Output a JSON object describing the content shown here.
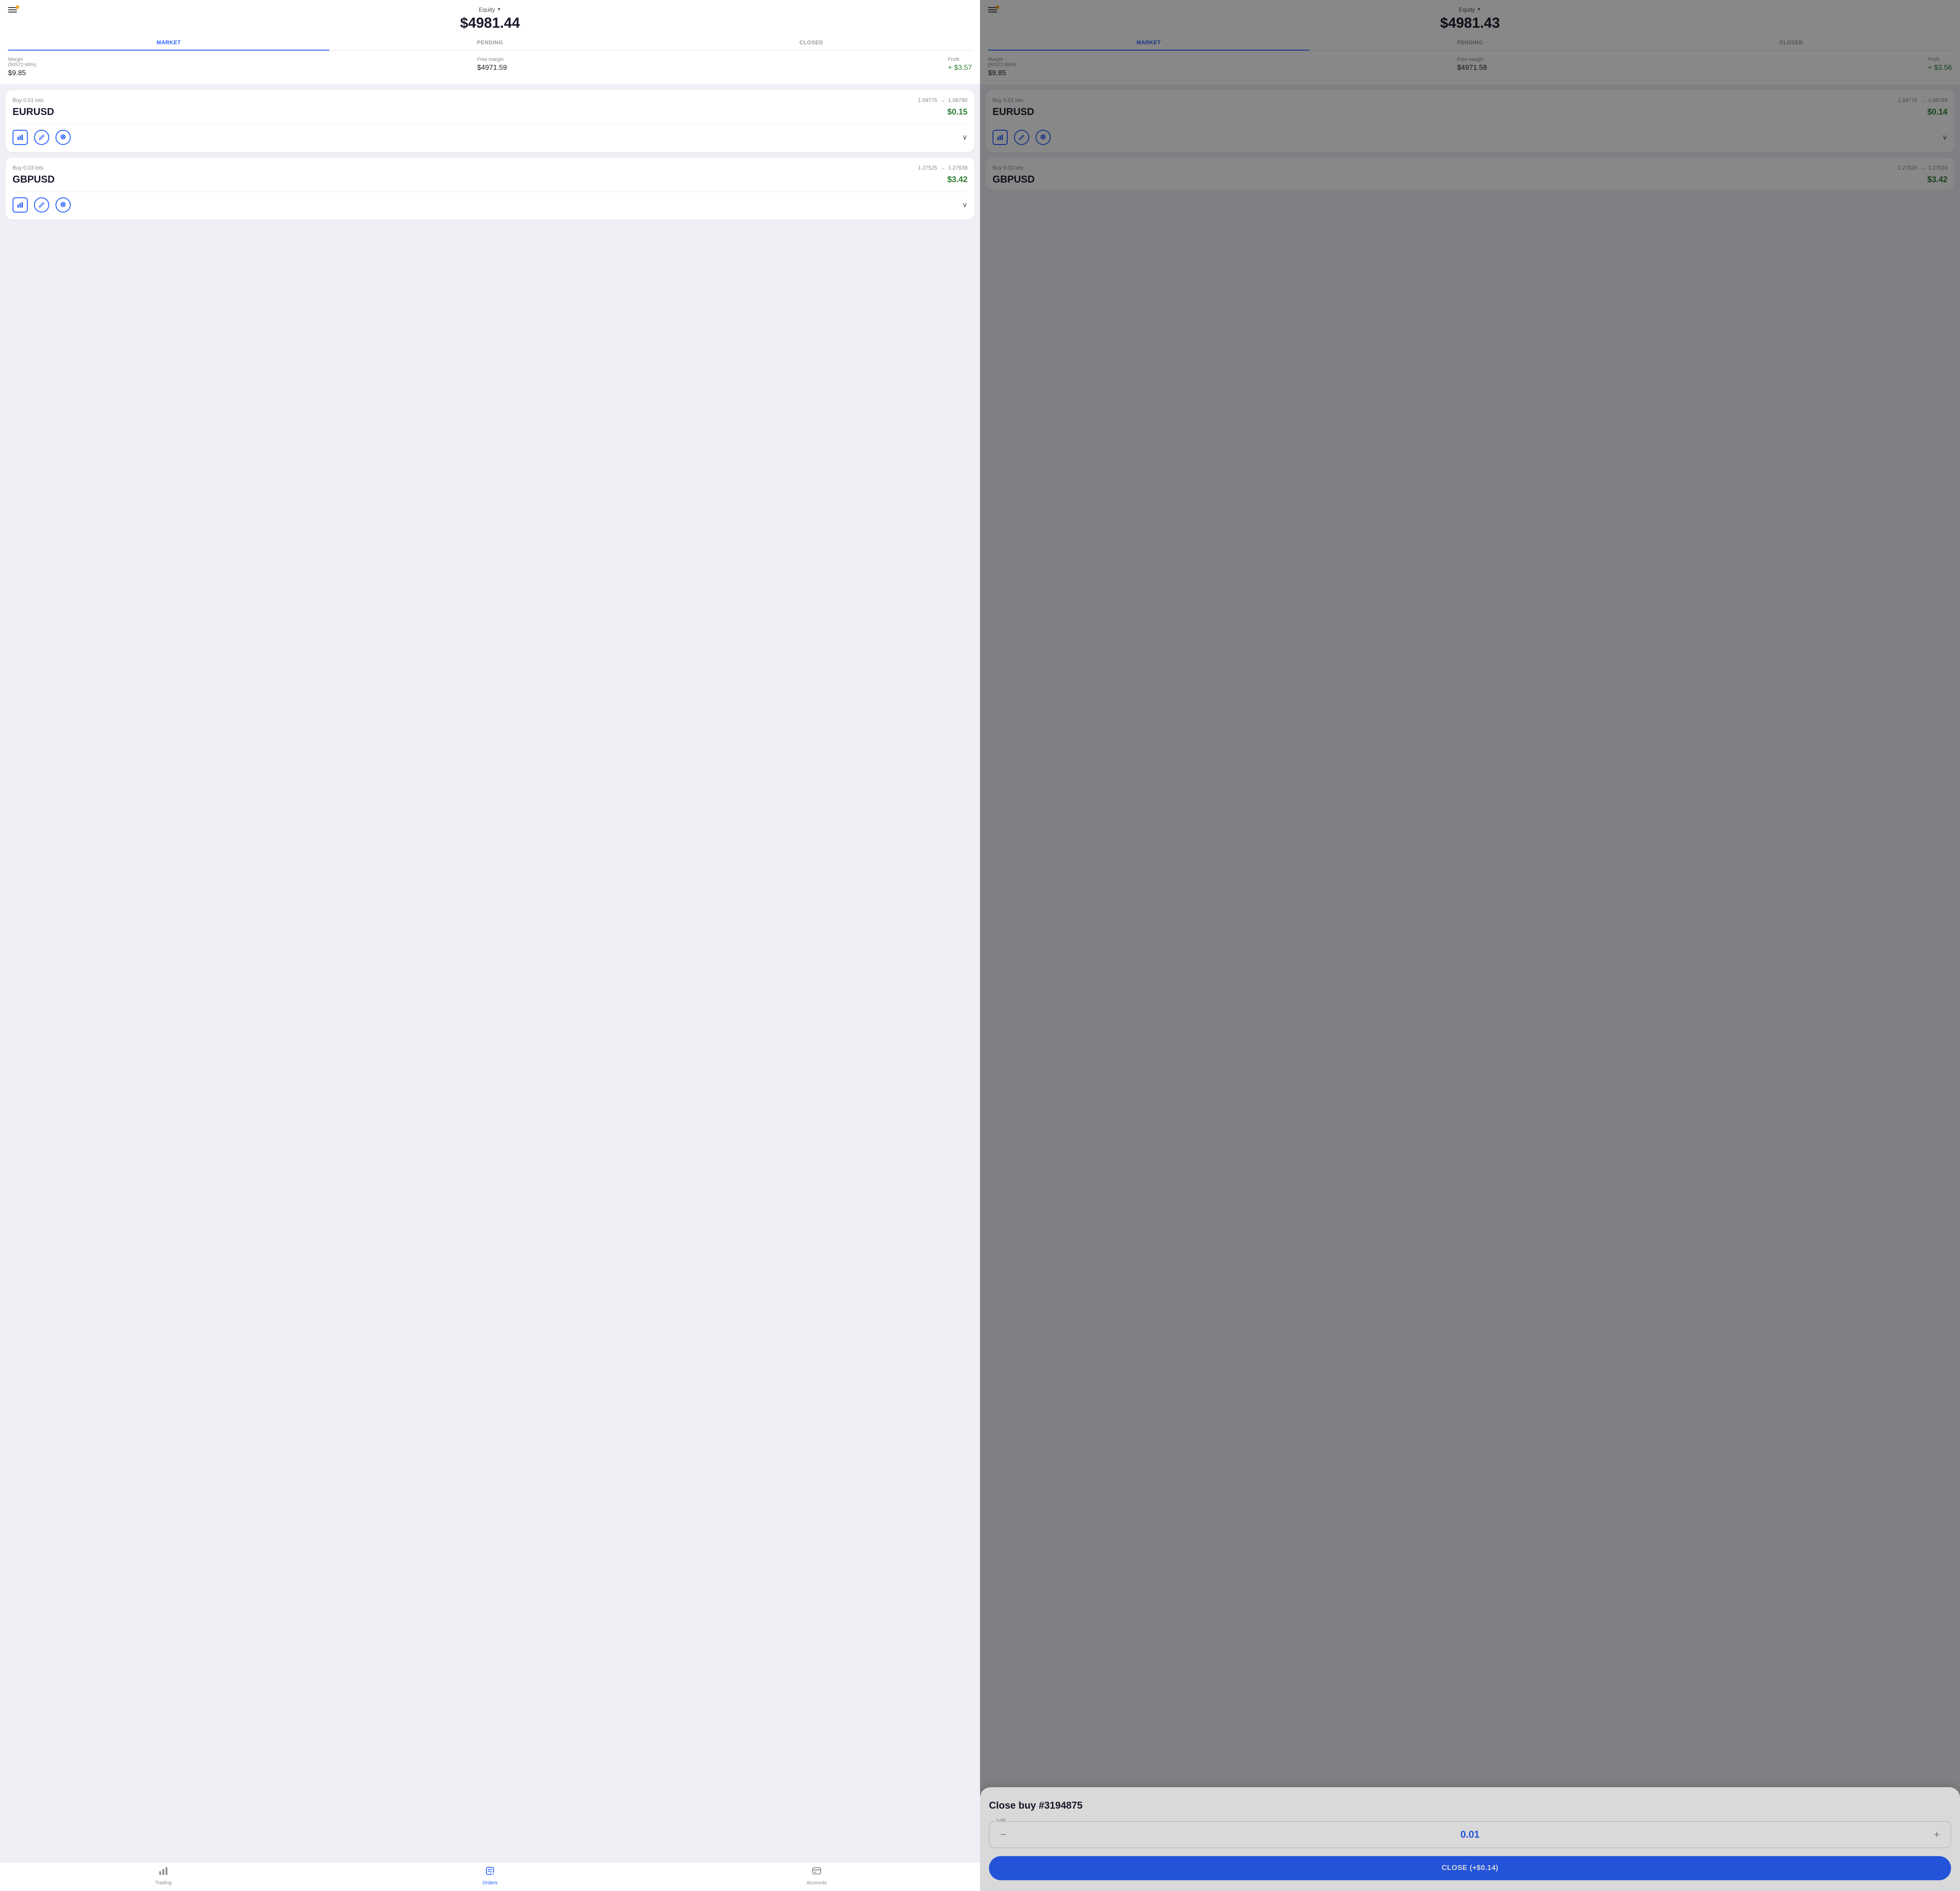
{
  "left": {
    "equity_label": "Equity",
    "equity_value": "$4981.44",
    "tabs": [
      {
        "id": "market",
        "label": "MARKET",
        "active": true
      },
      {
        "id": "pending",
        "label": "PENDING",
        "active": false
      },
      {
        "id": "closed",
        "label": "CLOSED",
        "active": false
      }
    ],
    "stats": {
      "margin_label": "Margin",
      "margin_pct": "(50572.99%)",
      "margin_value": "$9.85",
      "free_margin_label": "Free margin",
      "free_margin_value": "$4971.59",
      "profit_label": "Profit",
      "profit_value": "+ $3.57"
    },
    "trades": [
      {
        "id": "trade1",
        "type": "Buy 0.01 lots",
        "price_from": "1.09775",
        "price_to": "1.09790",
        "symbol": "EURUSD",
        "profit": "$0.15"
      },
      {
        "id": "trade2",
        "type": "Buy 0.03 lots",
        "price_from": "1.27525",
        "price_to": "1.27639",
        "symbol": "GBPUSD",
        "profit": "$3.42"
      }
    ],
    "nav": [
      {
        "id": "trading",
        "label": "Trading",
        "active": false,
        "icon": "📊"
      },
      {
        "id": "orders",
        "label": "Orders",
        "active": true,
        "icon": "💼"
      },
      {
        "id": "accounts",
        "label": "Accounts",
        "active": false,
        "icon": "💳"
      }
    ]
  },
  "right": {
    "equity_label": "Equity",
    "equity_value": "$4981.43",
    "tabs": [
      {
        "id": "market",
        "label": "MARKET",
        "active": true
      },
      {
        "id": "pending",
        "label": "PENDING",
        "active": false
      },
      {
        "id": "closed",
        "label": "CLOSED",
        "active": false
      }
    ],
    "stats": {
      "margin_label": "Margin",
      "margin_pct": "(50572.89%)",
      "margin_value": "$9.85",
      "free_margin_label": "Free margin",
      "free_margin_value": "$4971.58",
      "profit_label": "Profit",
      "profit_value": "+ $3.56"
    },
    "trades": [
      {
        "id": "trade1",
        "type": "Buy 0.01 lots",
        "price_from": "1.09775",
        "price_to": "1.09789",
        "symbol": "EURUSD",
        "profit": "$0.14"
      },
      {
        "id": "trade2",
        "type": "Buy 0.03 lots",
        "price_from": "1.27525",
        "price_to": "1.27639",
        "symbol": "GBPUSD",
        "profit": "$3.42"
      }
    ]
  },
  "modal": {
    "title": "Close buy #3194875",
    "lots_label": "Lots",
    "lots_value": "0.01",
    "minus_label": "−",
    "plus_label": "+",
    "close_button": "CLOSE (+$0.14)"
  }
}
